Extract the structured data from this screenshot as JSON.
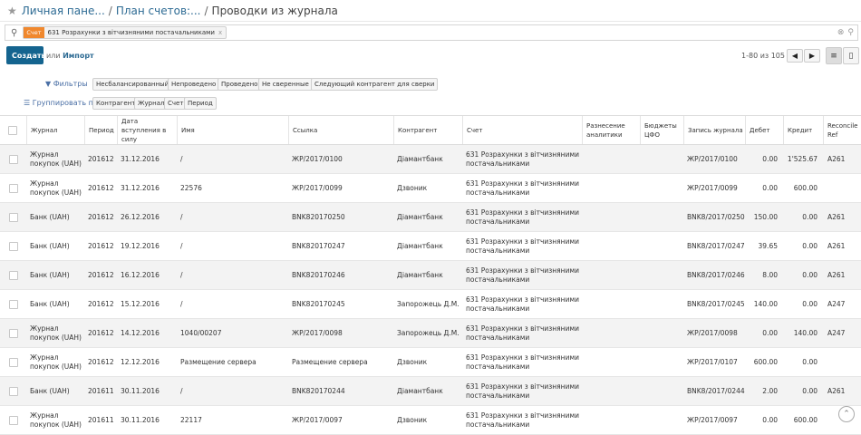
{
  "breadcrumb": {
    "items": [
      "Личная пане...",
      "План счетов:..."
    ],
    "current": "Проводки из журнала",
    "separator": "/"
  },
  "search": {
    "facet_label": "Счет",
    "facet_value": "631 Розрахунки з вітчизняними постачальниками",
    "facet_remove": "x",
    "placeholder": ""
  },
  "toolbar": {
    "create_label": "Создать",
    "or_label": "или",
    "import_label": "Импорт",
    "pager": "1-80 из 105"
  },
  "filters": {
    "label": "Фильтры",
    "items": [
      "Несбалансированный",
      "Непроведено",
      "Проведено",
      "Не сверенные",
      "Следующий контрагент для сверки"
    ]
  },
  "groupby": {
    "label": "Группировать по",
    "items": [
      "Контрагент",
      "Журнал",
      "Счет",
      "Период"
    ]
  },
  "table": {
    "columns": {
      "journal": "Журнал",
      "period": "Период",
      "date": "Дата вступления в силу",
      "name": "Имя",
      "ref": "Ссылка",
      "partner": "Контрагент",
      "account": "Счет",
      "analytic": "Разнесение аналитики",
      "budget": "Бюджеты ЦФО",
      "move": "Запись журнала",
      "debit": "Дебет",
      "credit": "Кредит",
      "reconcile": "Reconcile Ref"
    },
    "rows": [
      {
        "journal": "Журнал покупок (UAH)",
        "period": "201612",
        "date": "31.12.2016",
        "name": "/",
        "ref": "ЖР/2017/0100",
        "partner": "Діамантбанк",
        "account": "631 Розрахунки з вітчизняними постачальниками",
        "move": "ЖР/2017/0100",
        "debit": "0.00",
        "credit": "1'525.67",
        "reconcile": "A261"
      },
      {
        "journal": "Журнал покупок (UAH)",
        "period": "201612",
        "date": "31.12.2016",
        "name": "22576",
        "ref": "ЖР/2017/0099",
        "partner": "Дзвоник",
        "account": "631 Розрахунки з вітчизняними постачальниками",
        "move": "ЖР/2017/0099",
        "debit": "0.00",
        "credit": "600.00",
        "reconcile": ""
      },
      {
        "journal": "Банк (UAH)",
        "period": "201612",
        "date": "26.12.2016",
        "name": "/",
        "ref": "BNK820170250",
        "partner": "Діамантбанк",
        "account": "631 Розрахунки з вітчизняними постачальниками",
        "move": "BNK8/2017/0250",
        "debit": "150.00",
        "credit": "0.00",
        "reconcile": "A261"
      },
      {
        "journal": "Банк (UAH)",
        "period": "201612",
        "date": "19.12.2016",
        "name": "/",
        "ref": "BNK820170247",
        "partner": "Діамантбанк",
        "account": "631 Розрахунки з вітчизняними постачальниками",
        "move": "BNK8/2017/0247",
        "debit": "39.65",
        "credit": "0.00",
        "reconcile": "A261"
      },
      {
        "journal": "Банк (UAH)",
        "period": "201612",
        "date": "16.12.2016",
        "name": "/",
        "ref": "BNK820170246",
        "partner": "Діамантбанк",
        "account": "631 Розрахунки з вітчизняними постачальниками",
        "move": "BNK8/2017/0246",
        "debit": "8.00",
        "credit": "0.00",
        "reconcile": "A261"
      },
      {
        "journal": "Банк (UAH)",
        "period": "201612",
        "date": "15.12.2016",
        "name": "/",
        "ref": "BNK820170245",
        "partner": "Запорожець Д.М.",
        "account": "631 Розрахунки з вітчизняними постачальниками",
        "move": "BNK8/2017/0245",
        "debit": "140.00",
        "credit": "0.00",
        "reconcile": "A247"
      },
      {
        "journal": "Журнал покупок (UAH)",
        "period": "201612",
        "date": "14.12.2016",
        "name": "1040/00207",
        "ref": "ЖР/2017/0098",
        "partner": "Запорожець Д.М.",
        "account": "631 Розрахунки з вітчизняними постачальниками",
        "move": "ЖР/2017/0098",
        "debit": "0.00",
        "credit": "140.00",
        "reconcile": "A247"
      },
      {
        "journal": "Журнал покупок (UAH)",
        "period": "201612",
        "date": "12.12.2016",
        "name": "Размещение сервера",
        "ref": "Размещение сервера",
        "partner": "Дзвоник",
        "account": "631 Розрахунки з вітчизняними постачальниками",
        "move": "ЖР/2017/0107",
        "debit": "600.00",
        "credit": "0.00",
        "reconcile": ""
      },
      {
        "journal": "Банк (UAH)",
        "period": "201611",
        "date": "30.11.2016",
        "name": "/",
        "ref": "BNK820170244",
        "partner": "Діамантбанк",
        "account": "631 Розрахунки з вітчизняними постачальниками",
        "move": "BNK8/2017/0244",
        "debit": "2.00",
        "credit": "0.00",
        "reconcile": "A261"
      },
      {
        "journal": "Журнал покупок (UAH)",
        "period": "201611",
        "date": "30.11.2016",
        "name": "22117",
        "ref": "ЖР/2017/0097",
        "partner": "Дзвоник",
        "account": "631 Розрахунки з вітчизняними постачальниками",
        "move": "ЖР/2017/0097",
        "debit": "0.00",
        "credit": "600.00",
        "reconcile": ""
      }
    ]
  }
}
